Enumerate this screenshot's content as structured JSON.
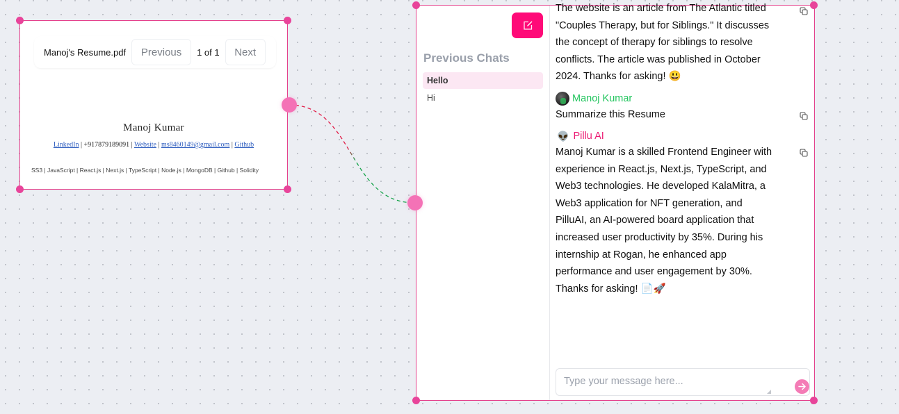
{
  "canvas": {
    "edge_colors": {
      "start": "#e11d48",
      "end": "#16a34a"
    }
  },
  "pdf_node": {
    "filename": "Manoj's Resume.pdf",
    "previous_label": "Previous",
    "page_indicator": "1 of 1",
    "next_label": "Next",
    "resume": {
      "name": "Manoj Kumar",
      "links": {
        "linkedin": "LinkedIn",
        "phone": "+917879189091",
        "website": "Website",
        "email": "ms8460149@gmail.com",
        "github": "Github"
      },
      "separator": " | ",
      "skills_line": "SS3 | JavaScript | React.js | Next.js | TypeScript | Node.js  | MongoDB | Github | Solidity"
    }
  },
  "chat_node": {
    "new_chat_icon": "edit-icon",
    "sidebar": {
      "title": "Previous Chats",
      "items": [
        {
          "label": "Hello",
          "active": true
        },
        {
          "label": "Hi",
          "active": false
        }
      ]
    },
    "messages": [
      {
        "role": "assistant",
        "partial": true,
        "lines": [
          "The website is an article from The Atlantic titled",
          "\"Couples Therapy, but for Siblings.\" It discusses",
          "the concept of therapy for siblings to resolve",
          "conflicts. The article was published in October",
          "2024. Thanks for asking! 😃"
        ]
      },
      {
        "role": "user",
        "sender": "Manoj Kumar",
        "sender_color": "#22c55e",
        "text": "Summarize this Resume"
      },
      {
        "role": "assistant",
        "sender": "Pillu AI",
        "sender_icon": "👽",
        "sender_color": "#ec1c74",
        "lines": [
          "Manoj Kumar is a skilled Frontend Engineer with",
          "experience in React.js, Next.js, TypeScript, and",
          "Web3 technologies. He developed KalaMitra, a",
          "Web3 application for NFT generation, and",
          "PilluAI, an AI-powered board application that",
          "increased user productivity by 35%. During his",
          "internship at Rogan, he enhanced app",
          "performance and user engagement by 30%.",
          "Thanks for asking! 📄🚀"
        ]
      }
    ],
    "composer": {
      "placeholder": "Type your message here...",
      "value": ""
    },
    "send_icon": "arrow-right-icon",
    "accent": "#ff0a78"
  }
}
